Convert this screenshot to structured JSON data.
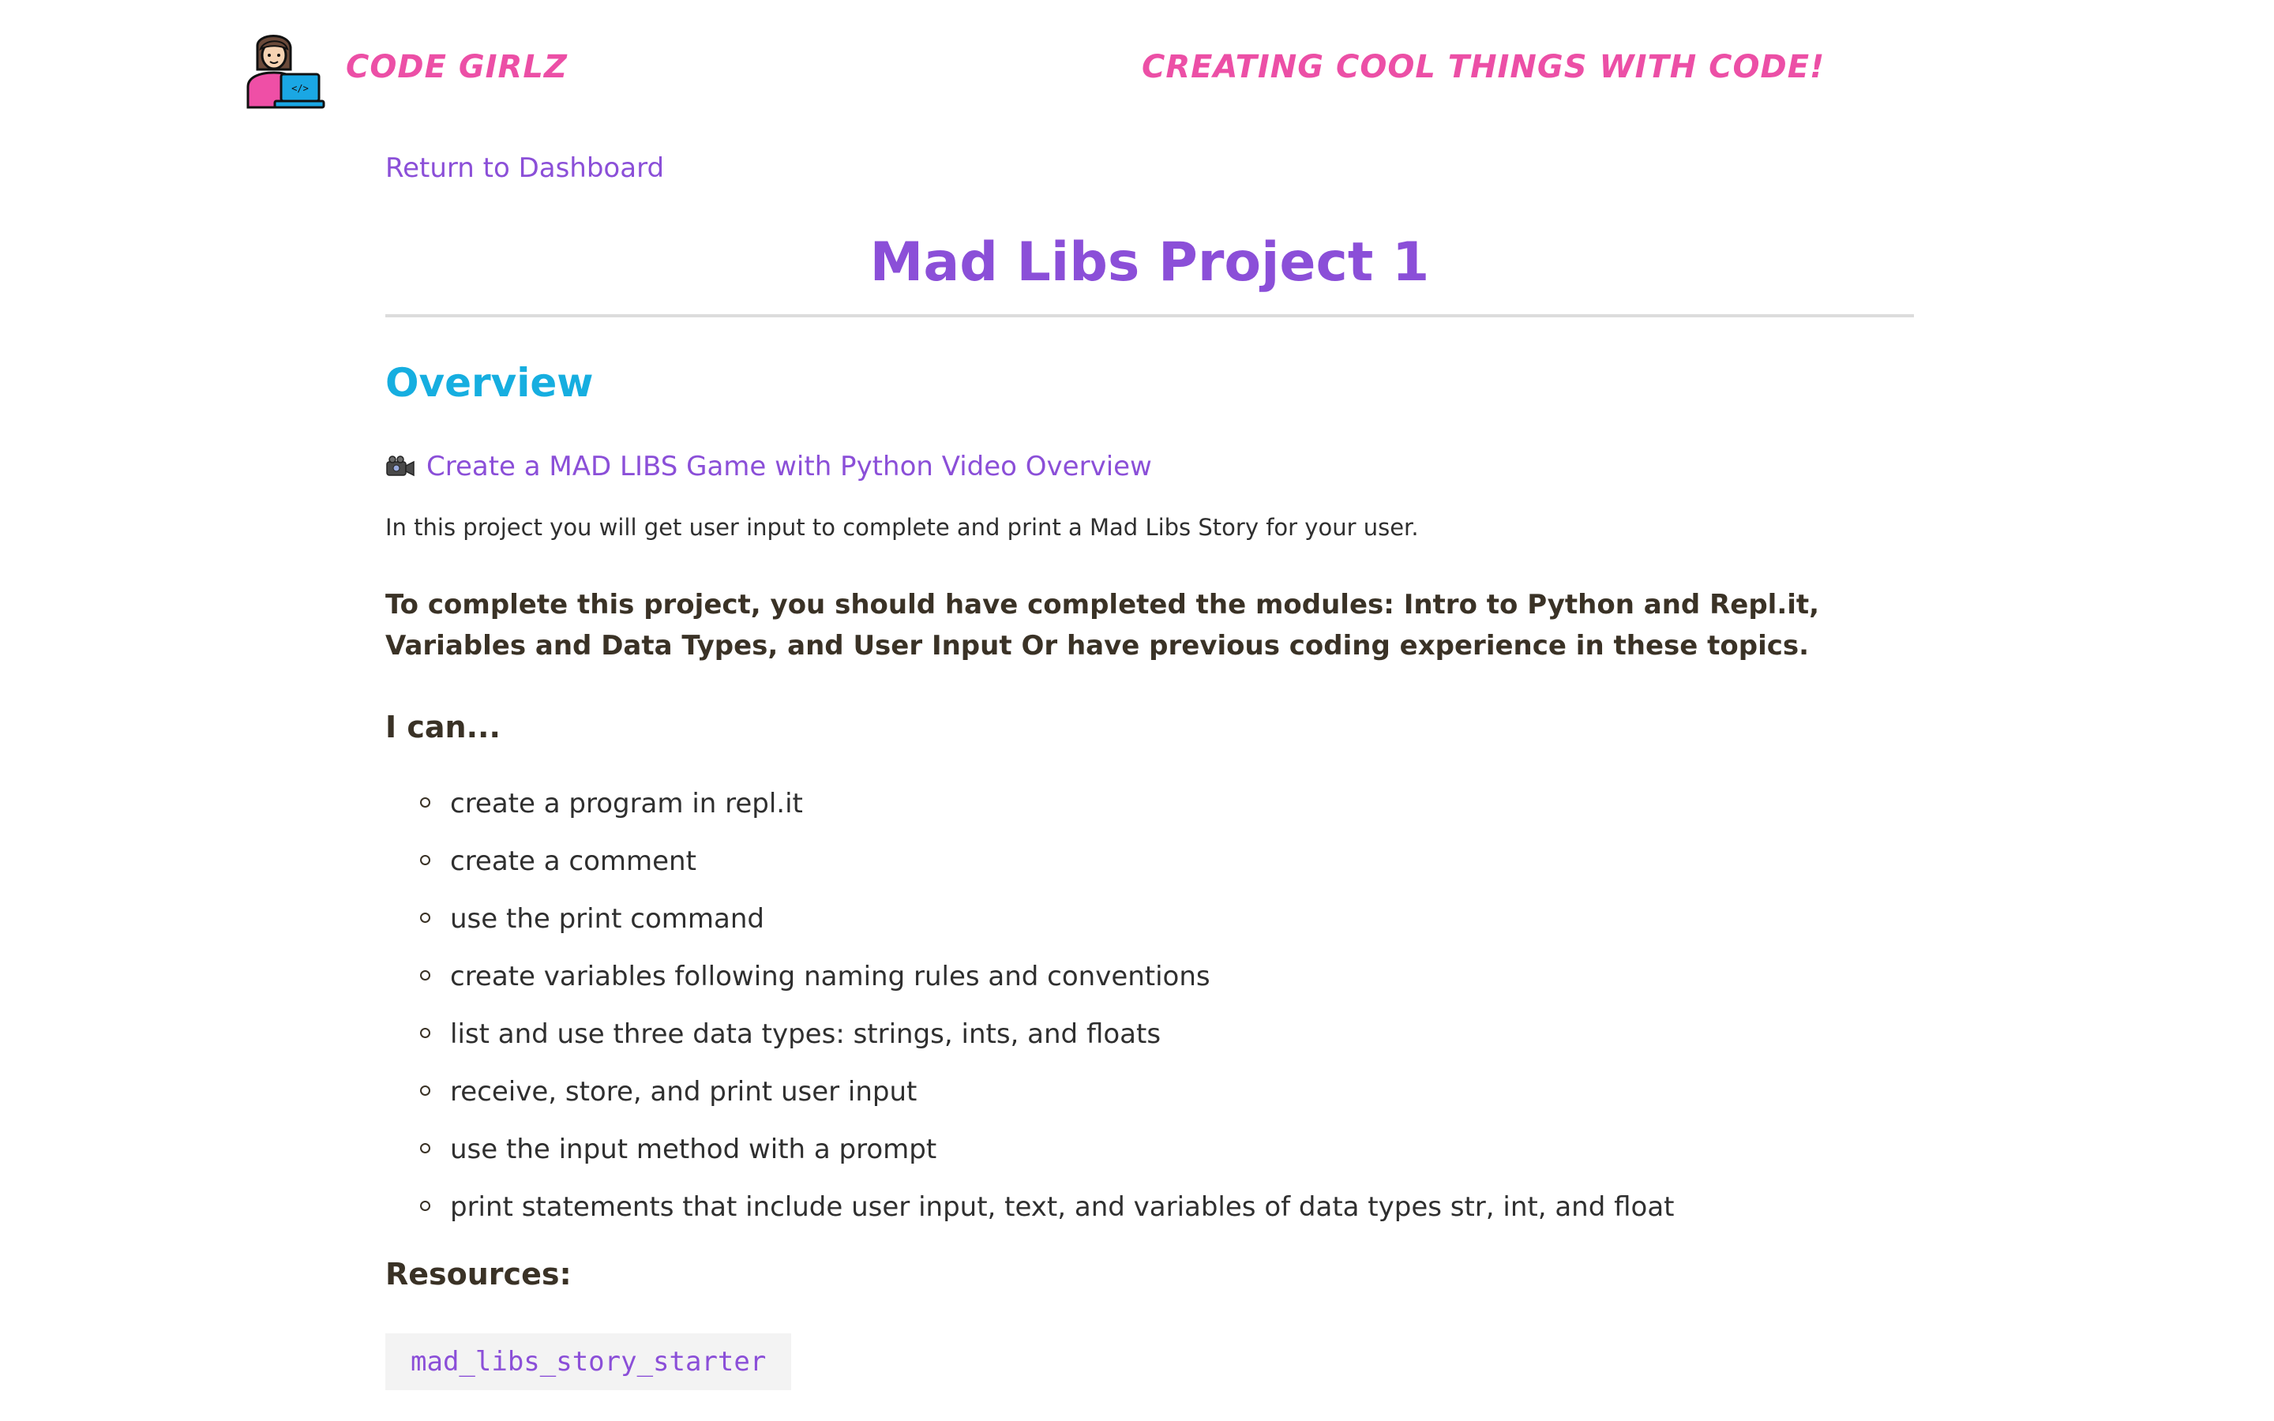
{
  "header": {
    "brand": "CODE GIRLZ",
    "tagline": "CREATING COOL THINGS WITH CODE!",
    "logo_icon": "girl-with-laptop-icon"
  },
  "nav": {
    "return_label": "Return to Dashboard"
  },
  "page": {
    "title": "Mad Libs Project 1"
  },
  "overview": {
    "heading": "Overview",
    "video_icon": "video-camera-icon",
    "video_link": "Create a MAD LIBS Game with Python Video Overview",
    "intro": "In this project you will get user input to complete and print a Mad Libs Story for your user.",
    "prerequisite": "To complete this project, you should have completed the modules: Intro to Python and Repl.it, Variables and Data Types, and User Input Or have previous coding experience in these topics."
  },
  "ican": {
    "heading": "I can...",
    "items": [
      "create a program in repl.it",
      "create a comment",
      "use the print command",
      "create variables following naming rules and conventions",
      "list and use three data types: strings, ints, and floats",
      "receive, store, and print user input",
      "use the input method with a prompt",
      "print statements that include user input, text, and variables of data types str, int, and float"
    ]
  },
  "resources": {
    "heading": "Resources:",
    "code_link": "mad_libs_story_starter"
  },
  "colors": {
    "brand_pink": "#ec4fa6",
    "link_purple": "#8b4fd8",
    "heading_blue": "#16aee0",
    "text_dark": "#3a3226"
  }
}
